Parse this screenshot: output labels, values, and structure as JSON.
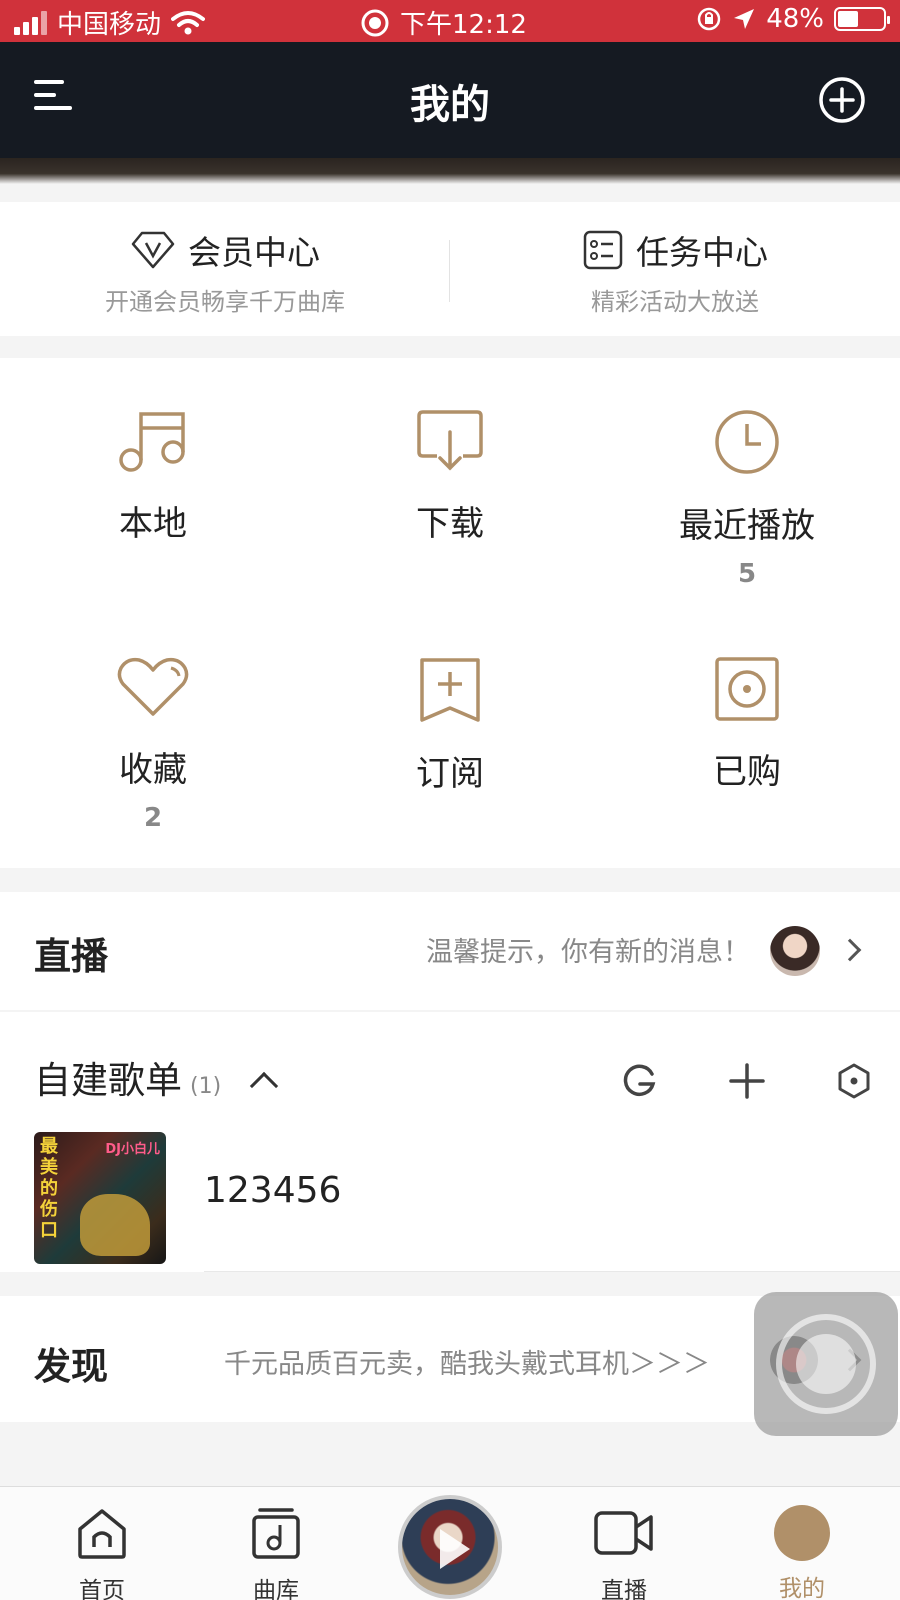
{
  "status_bar": {
    "carrier": "中国移动",
    "time": "下午12:12",
    "battery": "48%"
  },
  "header": {
    "title": "我的"
  },
  "member_card": {
    "vip": {
      "title": "会员中心",
      "subtitle": "开通会员畅享千万曲库"
    },
    "tasks": {
      "title": "任务中心",
      "subtitle": "精彩活动大放送"
    }
  },
  "grid": {
    "items": [
      {
        "label": "本地",
        "count": ""
      },
      {
        "label": "下载",
        "count": ""
      },
      {
        "label": "最近播放",
        "count": "5"
      },
      {
        "label": "收藏",
        "count": "2"
      },
      {
        "label": "订阅",
        "count": ""
      },
      {
        "label": "已购",
        "count": ""
      }
    ]
  },
  "live": {
    "title": "直播",
    "hint": "温馨提示，你有新的消息！"
  },
  "playlists": {
    "title": "自建歌单",
    "count": "(1)",
    "items": [
      {
        "name": "123456",
        "cover_text": "最美的伤口",
        "cover_tag": "DJ小白儿"
      }
    ]
  },
  "discover": {
    "title": "发现",
    "promo": "千元品质百元卖，酷我头戴式耳机＞＞＞"
  },
  "tab_bar": {
    "tabs": [
      {
        "label": "首页",
        "icon": "home-icon"
      },
      {
        "label": "曲库",
        "icon": "library-icon"
      },
      {
        "label": "",
        "icon": "play-icon"
      },
      {
        "label": "直播",
        "icon": "video-icon"
      },
      {
        "label": "我的",
        "icon": "profile-icon"
      }
    ],
    "active": "我的"
  },
  "colors": {
    "status_bar": "#d0323b",
    "nav_bar": "#151a22",
    "accent_gold": "#b09069"
  }
}
